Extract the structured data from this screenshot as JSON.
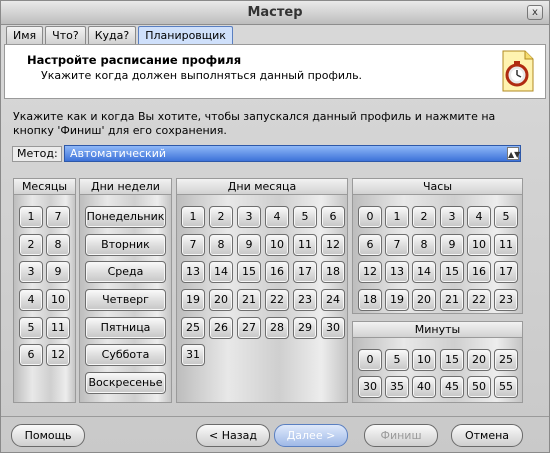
{
  "window": {
    "title": "Мастер",
    "close_glyph": "x"
  },
  "tabs": [
    "Имя",
    "Что?",
    "Куда?",
    "Планировщик"
  ],
  "header": {
    "title": "Настройте расписание профиля",
    "subtitle": "Укажите когда должен выполняться данный профиль."
  },
  "description": "Укажите как и когда Вы хотите, чтобы запускался данный профиль и нажмите на кнопку 'Финиш' для его сохранения.",
  "method": {
    "label": "Метод:",
    "value": "Автоматический"
  },
  "months": {
    "title": "Месяцы",
    "items": [
      "1",
      "7",
      "2",
      "8",
      "3",
      "9",
      "4",
      "10",
      "5",
      "11",
      "6",
      "12"
    ]
  },
  "weekdays": {
    "title": "Дни недели",
    "items": [
      "Понедельник",
      "Вторник",
      "Среда",
      "Четверг",
      "Пятница",
      "Суббота",
      "Воскресенье"
    ]
  },
  "monthdays": {
    "title": "Дни месяца",
    "items": [
      "1",
      "2",
      "3",
      "4",
      "5",
      "6",
      "7",
      "8",
      "9",
      "10",
      "11",
      "12",
      "13",
      "14",
      "15",
      "16",
      "17",
      "18",
      "19",
      "20",
      "21",
      "22",
      "23",
      "24",
      "25",
      "26",
      "27",
      "28",
      "29",
      "30",
      "31"
    ]
  },
  "hours": {
    "title": "Часы",
    "items": [
      "0",
      "1",
      "2",
      "3",
      "4",
      "5",
      "6",
      "7",
      "8",
      "9",
      "10",
      "11",
      "12",
      "13",
      "14",
      "15",
      "16",
      "17",
      "18",
      "19",
      "20",
      "21",
      "22",
      "23"
    ]
  },
  "minutes": {
    "title": "Минуты",
    "items": [
      "0",
      "5",
      "10",
      "15",
      "20",
      "25",
      "30",
      "35",
      "40",
      "45",
      "50",
      "55"
    ]
  },
  "buttons": {
    "help": "Помощь",
    "back": "< Назад",
    "next": "Далее >",
    "finish": "Финиш",
    "cancel": "Отмена"
  }
}
